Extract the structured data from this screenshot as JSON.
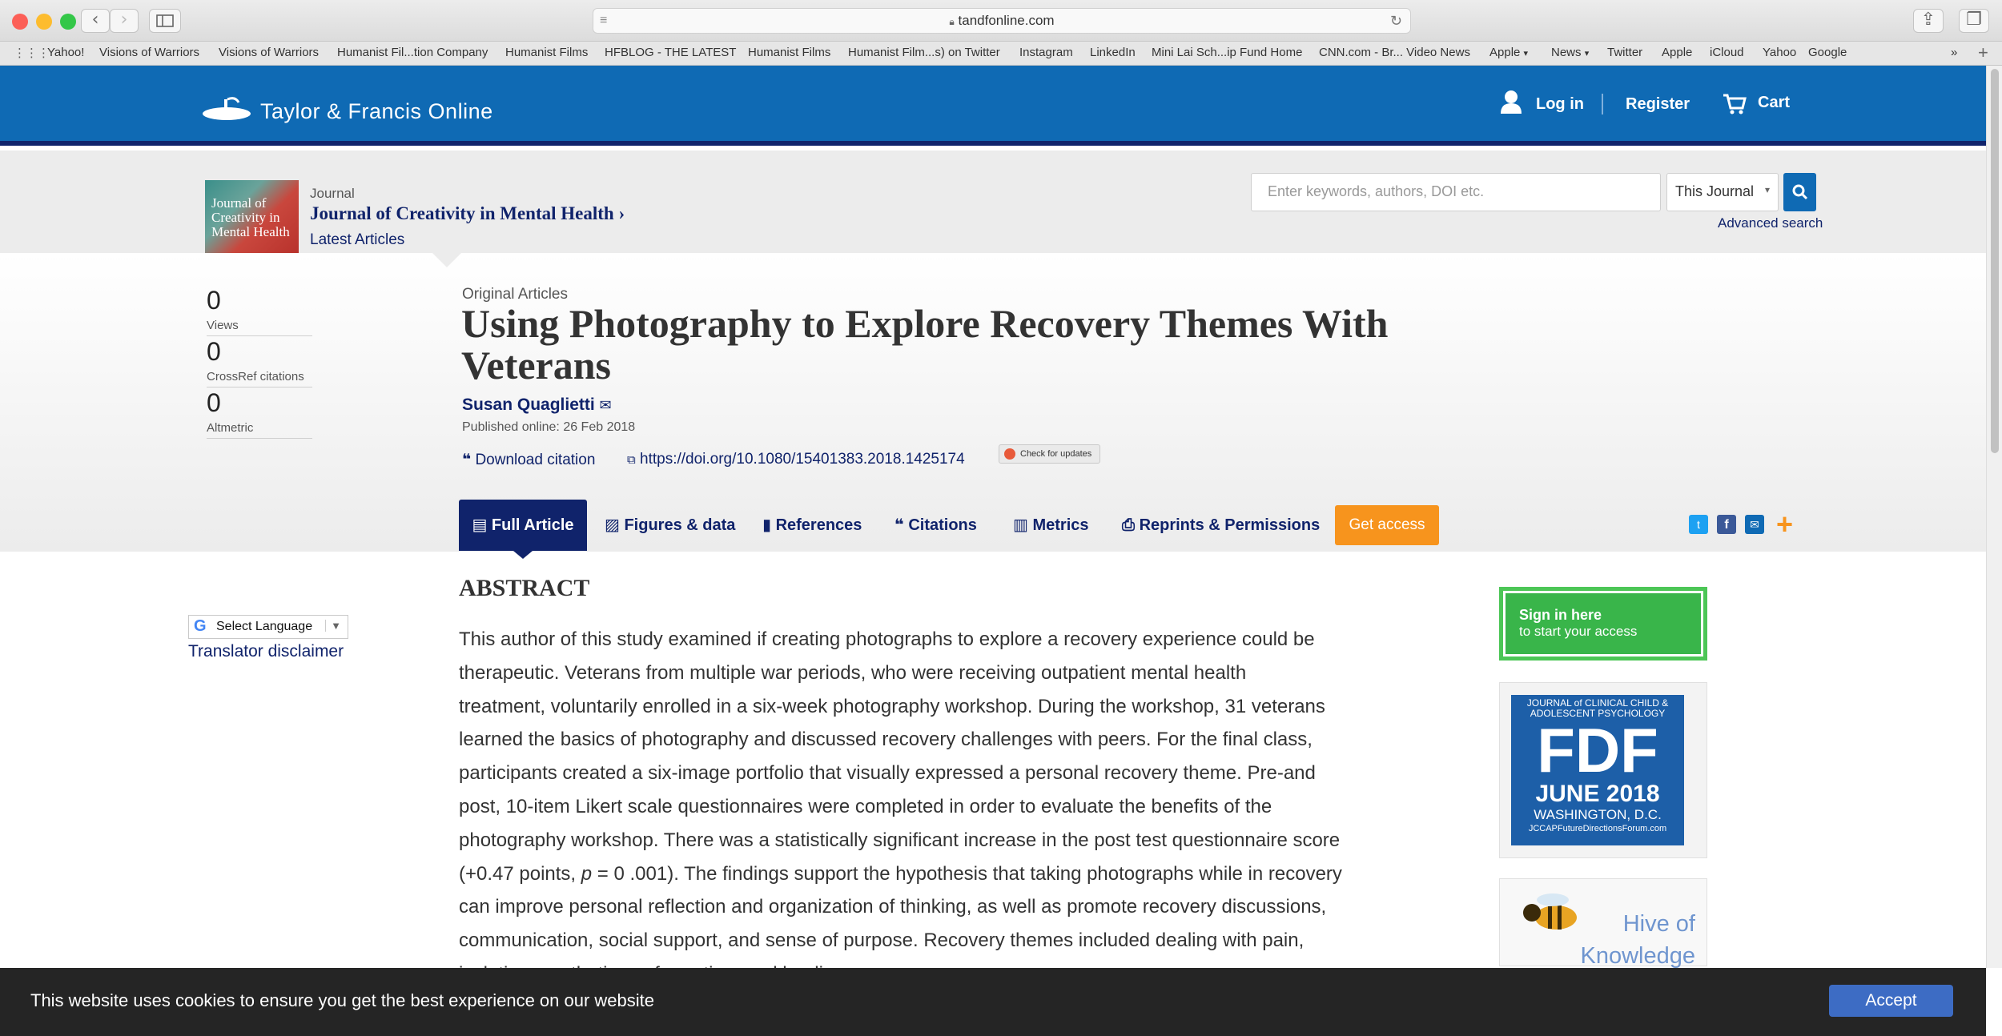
{
  "browser": {
    "url": "tandfonline.com",
    "bookmarks": [
      "Yahoo!",
      "Visions of Warriors",
      "Visions of Warriors",
      "Humanist Fil...tion Company",
      "Humanist Films",
      "HFBLOG - THE LATEST",
      "Humanist Films",
      "Humanist Film...s) on Twitter",
      "Instagram",
      "LinkedIn",
      "Mini Lai Sch...ip Fund Home",
      "CNN.com - Br... Video News",
      "Apple",
      "News",
      "Twitter",
      "Apple",
      "iCloud",
      "Yahoo",
      "Google"
    ]
  },
  "site": {
    "logo": "Taylor & Francis Online",
    "login": "Log in",
    "register": "Register",
    "cart": "Cart"
  },
  "journal": {
    "kicker": "Journal",
    "name": "Journal of Creativity in Mental Health",
    "latest": "Latest Articles",
    "cover_text": "Journal of Creativity in Mental Health"
  },
  "search": {
    "placeholder": "Enter keywords, authors, DOI etc.",
    "scope": "This Journal",
    "advanced": "Advanced search"
  },
  "metrics": [
    {
      "value": "0",
      "label": "Views"
    },
    {
      "value": "0",
      "label": "CrossRef citations"
    },
    {
      "value": "0",
      "label": "Altmetric"
    }
  ],
  "article": {
    "section": "Original Articles",
    "title": "Using Photography to Explore Recovery Themes With Veterans",
    "author": "Susan Quaglietti",
    "published": "Published online: 26 Feb 2018",
    "download_citation": "Download citation",
    "doi": "https://doi.org/10.1080/15401383.2018.1425174",
    "check_updates": "Check for updates"
  },
  "tabs": {
    "full": "Full Article",
    "figures": "Figures & data",
    "references": "References",
    "citations": "Citations",
    "metrics": "Metrics",
    "reprints": "Reprints & Permissions",
    "get_access": "Get access"
  },
  "abstract": {
    "heading": "ABSTRACT",
    "lines": [
      "This author of this study examined if creating photographs to explore a recovery experience could be",
      "therapeutic. Veterans from multiple war periods, who were receiving outpatient mental health",
      "treatment, voluntarily enrolled in a six-week photography workshop. During the workshop, 31 veterans",
      "learned the basics of photography and discussed recovery challenges with peers. For the final class,",
      "participants created a six-image portfolio that visually expressed a personal recovery theme. Pre-and",
      "post, 10-item Likert scale questionnaires were completed in order to evaluate the benefits of the",
      "photography workshop. There was a statistically significant increase in the post test questionnaire score",
      "can improve personal reflection and organization of thinking, as well as promote recovery discussions,",
      "communication, social support, and sense of purpose. Recovery themes included dealing with pain,"
    ],
    "line8_prefix": "(+0.47 points, ",
    "line8_p": "p",
    "line8_suffix": " = 0 .001). The findings support the hypothesis that taking photographs while in recovery",
    "partial_line": "isolation, aesthetics, reformation, and healing."
  },
  "sidebar": {
    "signin_line1": "Sign in here",
    "signin_line2": "to start your access",
    "ad1_top": "JOURNAL of CLINICAL CHILD & ADOLESCENT PSYCHOLOGY",
    "ad1_big": "FDF",
    "ad1_date": "JUNE 2018",
    "ad1_city": "WASHINGTON, D.C.",
    "ad1_url": "JCCAPFutureDirectionsForum.com",
    "ad2_line1": "Hive of",
    "ad2_line2": "Knowledge"
  },
  "translate": {
    "select": "Select Language",
    "disclaimer": "Translator disclaimer"
  },
  "cookie": {
    "text": "This website uses cookies to ensure you get the best experience on our website",
    "accept": "Accept"
  },
  "colors": {
    "brand_blue": "#0f6ab4",
    "navy": "#10236b",
    "orange": "#f7941d",
    "green": "#39b54a"
  }
}
